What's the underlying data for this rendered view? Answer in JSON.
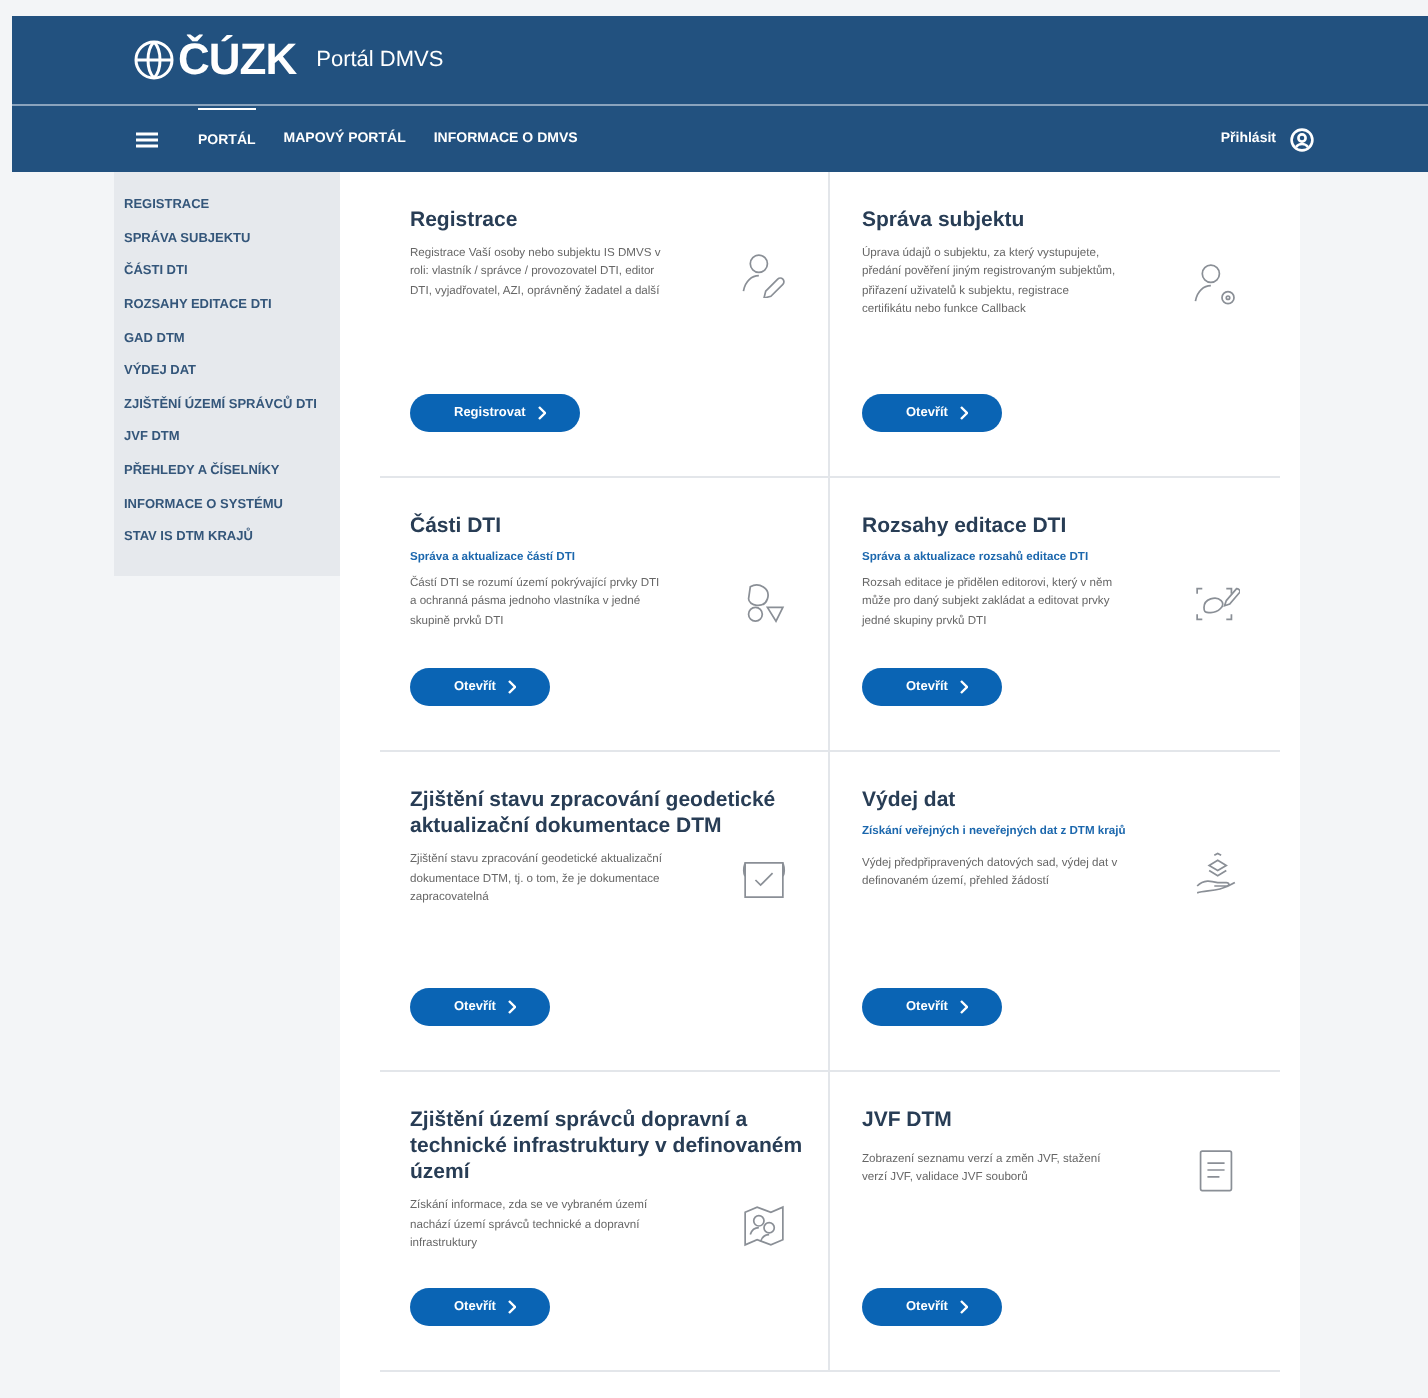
{
  "header": {
    "logo": "ČÚZK",
    "title": "Portál DMVS"
  },
  "nav": {
    "items": [
      {
        "label": "PORTÁL",
        "selected": true
      },
      {
        "label": "MAPOVÝ PORTÁL",
        "selected": false
      },
      {
        "label": "INFORMACE O DMVS",
        "selected": false
      }
    ],
    "login": "Přihlásit"
  },
  "sidebar": {
    "items": [
      {
        "label": "REGISTRACE"
      },
      {
        "label": "SPRÁVA SUBJEKTU"
      },
      {
        "label": "ČÁSTI DTI"
      },
      {
        "label": "ROZSAHY EDITACE DTI"
      },
      {
        "label": "GAD DTM"
      },
      {
        "label": "VÝDEJ DAT"
      },
      {
        "label": "ZJIŠTĚNÍ ÚZEMÍ SPRÁVCŮ DTI"
      },
      {
        "label": "JVF DTM"
      },
      {
        "label": "PŘEHLEDY A ČÍSELNÍKY"
      },
      {
        "label": "INFORMACE O SYSTÉMU"
      },
      {
        "label": "STAV IS DTM KRAJŮ"
      }
    ]
  },
  "cards": [
    {
      "title": "Registrace",
      "description": "Registrace Vaší osoby nebo subjektu IS DMVS v roli: vlastník / správce / provozovatel DTI, editor DTI, vyjadřovatel, AZI, oprávněný žadatel a další",
      "button": "Registrovat"
    },
    {
      "title": "Správa subjektu",
      "description": "Úprava údajů o subjektu, za který vystupujete, předání pověření jiným registrovaným subjektům, přiřazení uživatelů k subjektu, registrace certifikátu nebo funkce Callback",
      "button": "Otevřít"
    },
    {
      "title": "Části DTI",
      "subtitle": "Správa a aktualizace částí DTI",
      "description": "Částí DTI se rozumí území pokrývající prvky DTI a ochranná pásma jednoho vlastníka v jedné skupině prvků DTI",
      "button": "Otevřít"
    },
    {
      "title": "Rozsahy editace DTI",
      "subtitle": "Správa a aktualizace rozsahů editace DTI",
      "description": "Rozsah editace je přidělen editorovi, který v něm může pro daný subjekt zakládat a editovat prvky jedné skupiny prvků DTI",
      "button": "Otevřít"
    },
    {
      "title": "Zjištění stavu zpracování geodetické aktualizační dokumentace DTM",
      "description": "Zjištění stavu zpracování geodetické aktualizační dokumentace DTM, tj. o tom, že je dokumentace zapracovatelná",
      "button": "Otevřít"
    },
    {
      "title": "Výdej dat",
      "subtitle": "Získání veřejných i neveřejných dat z DTM krajů",
      "description": "Výdej předpřipravených datových sad, výdej dat v definovaném území, přehled žádostí",
      "button": "Otevřít"
    },
    {
      "title": "Zjištění území správců dopravní a technické infrastruktury v definovaném území",
      "description": "Získání informace, zda se ve vybraném území nachází území správců technické a dopravní infrastruktury",
      "button": "Otevřít"
    },
    {
      "title": "JVF DTM",
      "description": "Zobrazení seznamu verzí a změn JVF, stažení verzí JVF, validace JVF souborů",
      "button": "Otevřít"
    }
  ]
}
